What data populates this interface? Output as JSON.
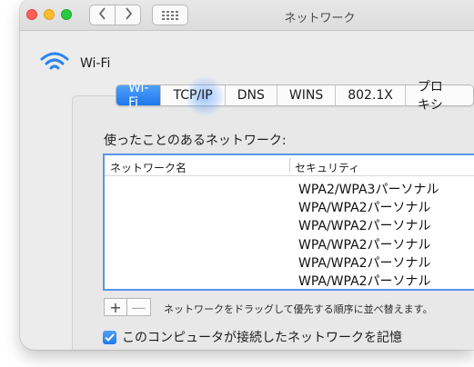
{
  "window": {
    "title": "ネットワーク"
  },
  "header": {
    "label": "Wi-Fi"
  },
  "tabs": [
    {
      "label": "Wi-Fi",
      "selected": true
    },
    {
      "label": "TCP/IP",
      "selected": false
    },
    {
      "label": "DNS",
      "selected": false
    },
    {
      "label": "WINS",
      "selected": false
    },
    {
      "label": "802.1X",
      "selected": false
    },
    {
      "label": "プロキシ",
      "selected": false
    }
  ],
  "networks": {
    "section_label": "使ったことのあるネットワーク:",
    "columns": {
      "name": "ネットワーク名",
      "security": "セキュリティ"
    },
    "rows": [
      {
        "name": "",
        "security": "WPA2/WPA3パーソナル"
      },
      {
        "name": "",
        "security": "WPA/WPA2パーソナル"
      },
      {
        "name": "",
        "security": "WPA/WPA2パーソナル"
      },
      {
        "name": "",
        "security": "WPA/WPA2パーソナル"
      },
      {
        "name": "",
        "security": "WPA/WPA2パーソナル"
      },
      {
        "name": "",
        "security": "WPA/WPA2パーソナル"
      }
    ],
    "add_symbol": "+",
    "remove_symbol": "—",
    "hint": "ネットワークをドラッグして優先する順序に並べ替えます。"
  },
  "remember": {
    "label": "このコンピュータが接続したネットワークを記憶",
    "checked": true
  },
  "colors": {
    "accent": "#2a84f3",
    "table_border": "#5a95e8"
  }
}
